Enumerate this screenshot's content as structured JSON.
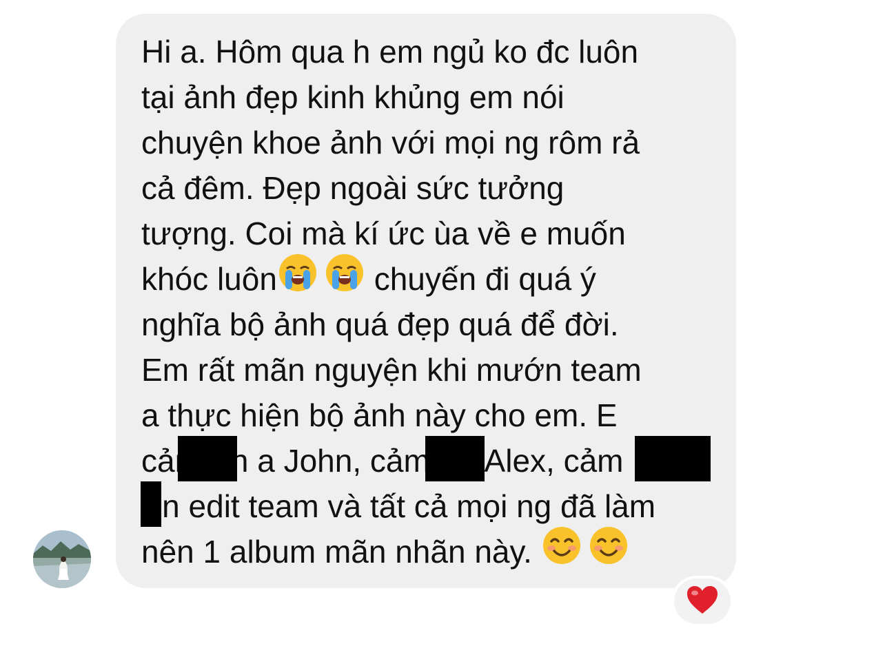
{
  "message": {
    "lines": [
      "Hi a. Hôm qua h em ngủ ko đc luôn",
      "tại ảnh đẹp kinh khủng em nói",
      "chuyện khoe ảnh với mọi ng rôm rả",
      "cả đêm. Đẹp ngoài sức tưởng",
      "tượng. Coi mà kí ức ùa về e muốn"
    ],
    "line6_before": "khóc luôn",
    "line6_after": " chuyến đi quá ý",
    "lines_b": [
      "nghĩa bộ ảnh quá đẹp quá để đời.",
      "Em rất mãn nguyện khi mướn team",
      "a thực hiện bộ ảnh này cho em. E",
      "cảm ơn a John, cảm ơn Alex, cảm",
      "ơn edit team và tất cả mọi ng đã làm"
    ],
    "last_line": "nên 1 album mãn nhãn này. "
  },
  "emojis": {
    "crying": "loudly-crying-face-icon",
    "smiling": "smiling-face-icon"
  },
  "reaction": {
    "icon": "heart-icon",
    "color": "#e0202a"
  },
  "colors": {
    "bubble": "#efefef",
    "text": "#111111",
    "redaction": "#000000"
  }
}
